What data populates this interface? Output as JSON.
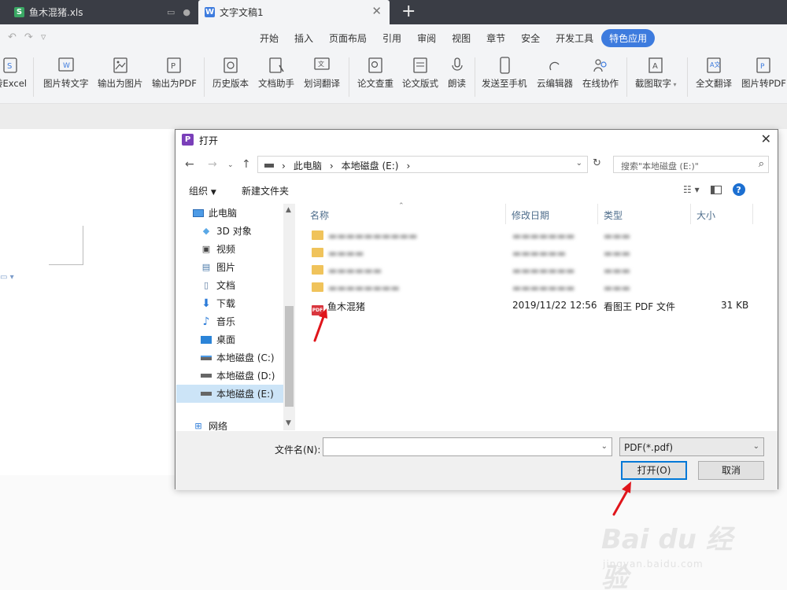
{
  "tabs": [
    {
      "label": "鱼木混猪.xls",
      "badge": "S",
      "badge_color": "#3aa864"
    },
    {
      "label": "文字文稿1",
      "badge": "W",
      "badge_color": "#3d7bde"
    }
  ],
  "menu": [
    "开始",
    "插入",
    "页面布局",
    "引用",
    "审阅",
    "视图",
    "章节",
    "安全",
    "开发工具",
    "特色应用"
  ],
  "menu_active": "特色应用",
  "ribbon": [
    "转Excel",
    "图片转文字",
    "输出为图片",
    "输出为PDF",
    "历史版本",
    "文档助手",
    "划词翻译",
    "论文查重",
    "论文版式",
    "朗读",
    "发送至手机",
    "云编辑器",
    "在线协作",
    "截图取字",
    "全文翻译",
    "图片转PDF"
  ],
  "dialog": {
    "title": "打开",
    "title_icon": "P",
    "address": [
      "此电脑",
      "本地磁盘 (E:)"
    ],
    "search_placeholder": "搜索\"本地磁盘 (E:)\"",
    "organize": "组织",
    "new_folder": "新建文件夹",
    "nav": [
      {
        "label": "此电脑",
        "icon": "computer-icon"
      },
      {
        "label": "3D 对象",
        "icon": "cube-icon"
      },
      {
        "label": "视频",
        "icon": "video-icon"
      },
      {
        "label": "图片",
        "icon": "picture-icon"
      },
      {
        "label": "文档",
        "icon": "document-icon"
      },
      {
        "label": "下载",
        "icon": "download-icon"
      },
      {
        "label": "音乐",
        "icon": "music-icon"
      },
      {
        "label": "桌面",
        "icon": "desktop-icon"
      },
      {
        "label": "本地磁盘 (C:)",
        "icon": "drive-icon"
      },
      {
        "label": "本地磁盘 (D:)",
        "icon": "drive-icon"
      },
      {
        "label": "本地磁盘 (E:)",
        "icon": "drive-icon"
      },
      {
        "label": "网络",
        "icon": "network-icon"
      }
    ],
    "columns": [
      "名称",
      "修改日期",
      "类型",
      "大小"
    ],
    "file": {
      "name": "鱼木混猪",
      "date": "2019/11/22 12:56",
      "type": "看图王 PDF 文件",
      "size": "31 KB"
    },
    "filename_label": "文件名(N):",
    "filter": "PDF(*.pdf)",
    "open_button": "打开(O)",
    "cancel_button": "取消"
  },
  "watermark": {
    "brand": "Bai du 经验",
    "url": "jingyan.baidu.com"
  },
  "colors": {
    "accent": "#3d7bde",
    "annotation_arrow": "#e0151b"
  }
}
